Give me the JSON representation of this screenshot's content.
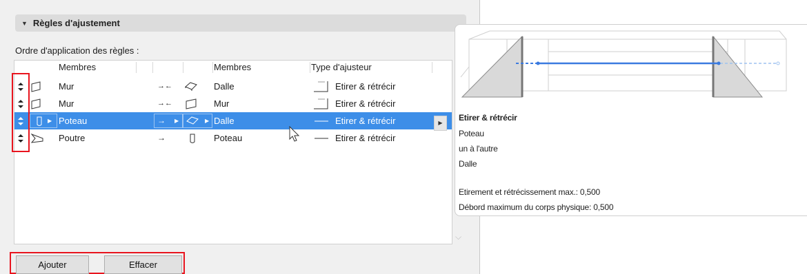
{
  "section": {
    "title": "Règles d'ajustement",
    "toggle_icon": "triangle-down-icon"
  },
  "order_label": "Ordre d'application des règles :",
  "table": {
    "headers": {
      "members_from": "Membres",
      "members_to": "Membres",
      "adjuster_type": "Type d'ajusteur"
    },
    "rows": [
      {
        "from": "Mur",
        "arrow": "→←",
        "to": "Dalle",
        "adjuster": "Etirer & rétrécir",
        "from_icon": "wall-icon",
        "to_icon": "slab-icon",
        "adjuster_icon": "stretch-shrink-icon"
      },
      {
        "from": "Mur",
        "arrow": "→←",
        "to": "Mur",
        "adjuster": "Etirer & rétrécir",
        "from_icon": "wall-icon",
        "to_icon": "wall-icon",
        "adjuster_icon": "stretch-shrink-icon"
      },
      {
        "from": "Poteau",
        "arrow": "→",
        "to": "Dalle",
        "adjuster": "Etirer & rétrécir",
        "from_icon": "column-icon",
        "to_icon": "slab-icon",
        "adjuster_icon": "line-icon"
      },
      {
        "from": "Poutre",
        "arrow": "→",
        "to": "Poteau",
        "adjuster": "Etirer & rétrécir",
        "from_icon": "beam-icon",
        "to_icon": "column-icon",
        "adjuster_icon": "line-icon"
      }
    ],
    "selected_row": 2
  },
  "buttons": {
    "add": "Ajouter",
    "clear": "Effacer"
  },
  "tooltip": {
    "title": "Etirer & rétrécir",
    "from": "Poteau",
    "relation": "un à l'autre",
    "to": "Dalle",
    "max_stretch": "Etirement et rétrécissement max.: 0,500",
    "max_overhang": "Débord maximum du corps physique: 0,500"
  },
  "colors": {
    "selection": "#3d8ee8",
    "highlight_box": "#e8141e",
    "diagram_line": "#3a7ae0"
  }
}
